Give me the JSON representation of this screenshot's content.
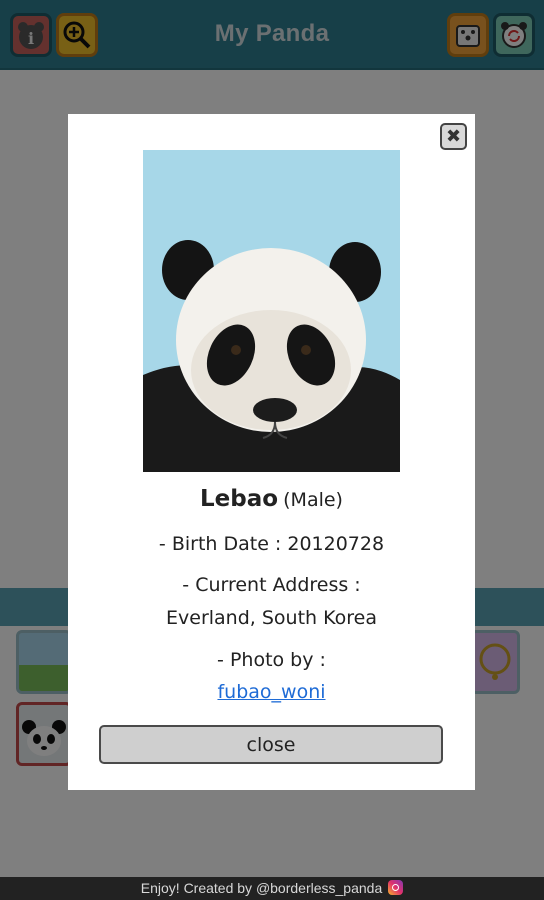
{
  "header": {
    "title": "My Panda",
    "buttons": [
      {
        "name": "info",
        "icon": "bear-info-icon"
      },
      {
        "name": "zoom",
        "icon": "zoom-in-icon"
      },
      {
        "name": "random",
        "icon": "dice-icon"
      },
      {
        "name": "switch",
        "icon": "refresh-icon"
      }
    ]
  },
  "modal": {
    "panda_name": "Lebao",
    "sex": "(Male)",
    "birth_date_line": "- Birth Date : 20120728",
    "address_label": "- Current Address :",
    "address_value": "Everland, South Korea",
    "photo_label": "- Photo by :",
    "photo_credit": "fubao_woni",
    "close_x_glyph": "✖",
    "close_button_label": "close"
  },
  "footer": {
    "text": "Enjoy! Created by @borderless_panda",
    "icon": "instagram-icon"
  },
  "colors": {
    "header_bg": "#2e7f91",
    "overlay": "rgba(0,0,0,0.5)",
    "link": "#1e6bd6"
  }
}
